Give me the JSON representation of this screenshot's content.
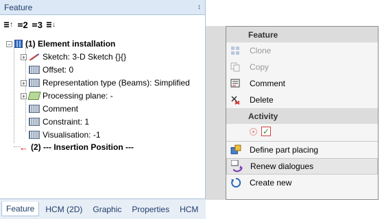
{
  "panel": {
    "title": "Feature",
    "pin_glyph": "↕",
    "toolbar": [
      {
        "icon": "sort-up-icon",
        "num": ""
      },
      {
        "icon": "level-2-icon",
        "num": "2"
      },
      {
        "icon": "level-3-icon",
        "num": "3"
      },
      {
        "icon": "sort-down-icon",
        "num": ""
      }
    ],
    "tree": {
      "root_expander": "−",
      "root_label": "(1) Element installation",
      "children": [
        {
          "label": "Sketch: 3-D Sketch {}{}",
          "icon": "sketch-icon",
          "expander": "+"
        },
        {
          "label": "Offset: 0",
          "icon": "parameter-icon",
          "expander": ""
        },
        {
          "label": "Representation type (Beams): Simplified",
          "icon": "parameter-icon",
          "expander": "+"
        },
        {
          "label": "Processing plane: -",
          "icon": "plane-icon",
          "expander": "+"
        },
        {
          "label": "Comment",
          "icon": "parameter-icon",
          "expander": ""
        },
        {
          "label": "Constraint: 1",
          "icon": "parameter-icon",
          "expander": ""
        },
        {
          "label": "Visualisation: -1",
          "icon": "parameter-icon",
          "expander": ""
        }
      ],
      "insertion_arrow": "←",
      "insertion_label": "(2) --- Insertion Position ---"
    },
    "tabs": [
      "Feature",
      "HCM (2D)",
      "Graphic",
      "Properties",
      "HCM"
    ],
    "active_tab": "Feature"
  },
  "menu": {
    "feature_header": "Feature",
    "feature_items": [
      {
        "label": "Clone",
        "icon": "clone-icon",
        "disabled": true
      },
      {
        "label": "Copy",
        "icon": "copy-icon",
        "disabled": true
      },
      {
        "label": "Comment",
        "icon": "comment-icon",
        "disabled": false
      },
      {
        "label": "Delete",
        "icon": "delete-icon",
        "disabled": false
      }
    ],
    "activity_header": "Activity",
    "activity_ok": "✓",
    "other_items": [
      {
        "label": "Define part placing",
        "icon": "define-part-icon"
      },
      {
        "label": "Renew dialogues",
        "icon": "renew-icon"
      },
      {
        "label": "Create new",
        "icon": "create-new-icon"
      }
    ]
  }
}
